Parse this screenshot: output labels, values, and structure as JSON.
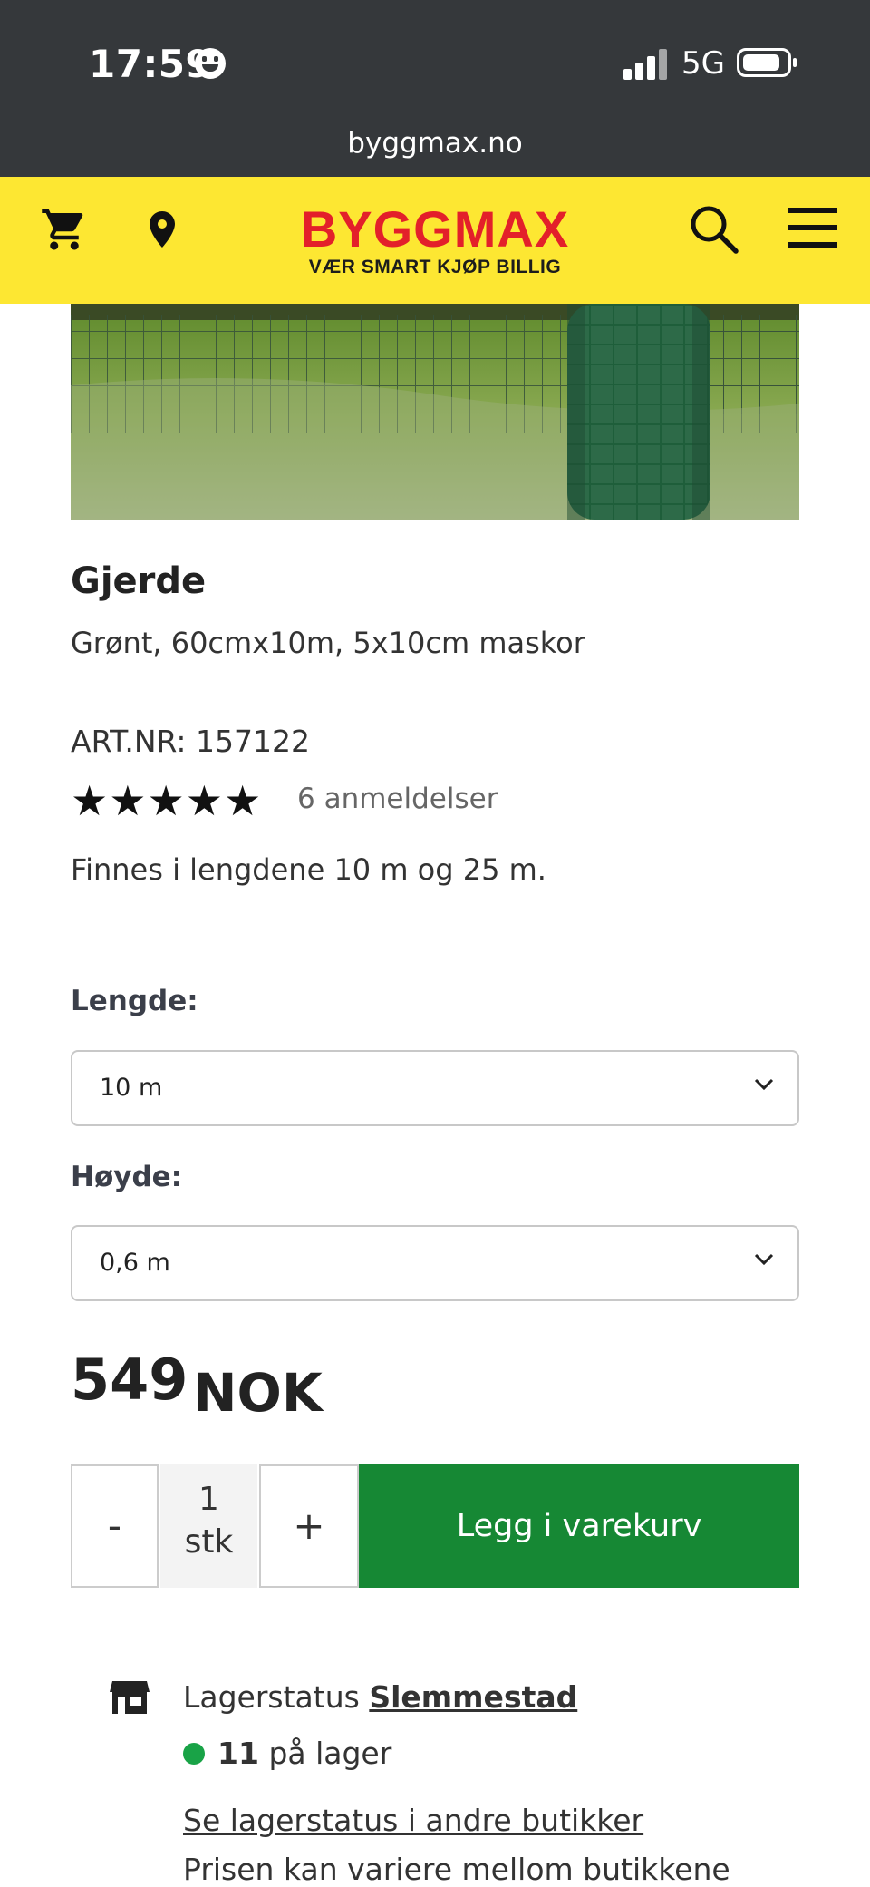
{
  "status_bar": {
    "time": "17:59",
    "network": "5G"
  },
  "browser": {
    "url": "byggmax.no"
  },
  "header": {
    "logo": "BYGGMAX",
    "tagline": "VÆR SMART KJØP BILLIG",
    "icons": [
      "cart-icon",
      "location-pin-icon",
      "search-icon",
      "menu-icon"
    ],
    "brand_color": "#fde732",
    "logo_color": "#e3202a"
  },
  "product": {
    "title": "Gjerde",
    "subtitle": "Grønt, 60cmx10m, 5x10cm maskor",
    "art_nr": "ART.NR: 157122",
    "rating": 5,
    "rating_stars": "★★★★★",
    "reviews": "6 anmeldelser",
    "description": "Finnes i lengdene 10 m og 25 m."
  },
  "options": {
    "length_label": "Lengde:",
    "length_value": "10 m",
    "height_label": "Høyde:",
    "height_value": "0,6 m"
  },
  "price": {
    "amount": "549",
    "currency": "NOK"
  },
  "cart": {
    "minus": "-",
    "plus": "+",
    "quantity": "1",
    "unit": "stk",
    "add_label": "Legg i varekurv",
    "button_color": "#168834"
  },
  "stock": {
    "label": "Lagerstatus",
    "store": "Slemmestad",
    "count": "11",
    "count_suffix": "på lager",
    "other_stores_link": "Se lagerstatus i andre butikker",
    "price_note": "Prisen kan variere mellom butikkene",
    "status_color": "#19a347"
  }
}
